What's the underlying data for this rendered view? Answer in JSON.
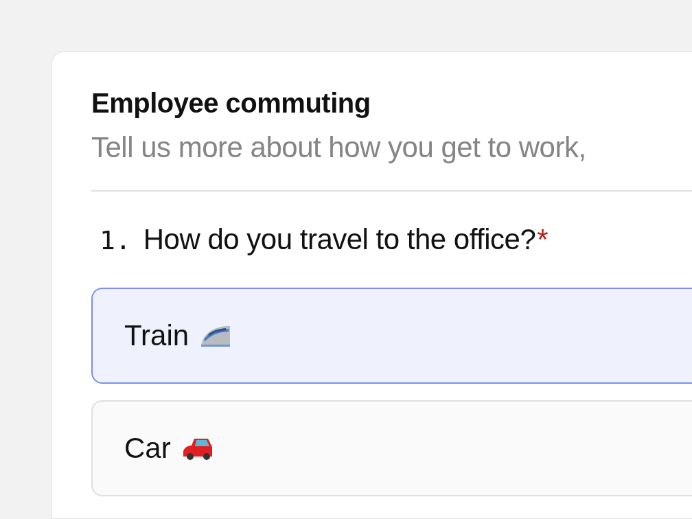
{
  "form": {
    "title": "Employee commuting",
    "description": "Tell us more about how you get to work,"
  },
  "question": {
    "number": "1.",
    "text": "How do you travel to the office?",
    "required": true,
    "required_mark": "*",
    "options": [
      {
        "label": "Train",
        "kind": "train",
        "selected": true
      },
      {
        "label": "Car",
        "kind": "car",
        "selected": false
      }
    ]
  }
}
